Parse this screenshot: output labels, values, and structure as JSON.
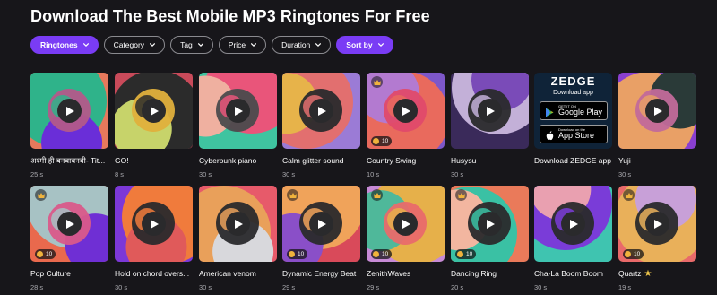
{
  "page_title": "Download The Best Mobile MP3 Ringtones For Free",
  "filters": [
    {
      "label": "Ringtones",
      "active": true
    },
    {
      "label": "Category",
      "active": false
    },
    {
      "label": "Tag",
      "active": false
    },
    {
      "label": "Price",
      "active": false
    },
    {
      "label": "Duration",
      "active": false
    },
    {
      "label": "Sort by",
      "active": true
    }
  ],
  "colors": {
    "accent": "#7a3cf5",
    "background": "#17161a",
    "coin": "#f0b33c"
  },
  "rows": [
    [
      {
        "name": "अश्मी ही बनवाबनवी- Tit...",
        "duration": "25 s",
        "premium": false,
        "price": "",
        "palette": [
          "#e6795c",
          "#2fb38a",
          "#6a2ed8",
          "#b35a8a"
        ]
      },
      {
        "name": "GO!",
        "duration": "8 s",
        "premium": false,
        "price": "",
        "palette": [
          "#c94a5a",
          "#2b2b2b",
          "#c7d36a",
          "#e0b03c"
        ]
      },
      {
        "name": "Cyberpunk piano",
        "duration": "30 s",
        "premium": false,
        "price": "",
        "palette": [
          "#3fc4a0",
          "#e9557a",
          "#efb0a0",
          "#4b4b4d"
        ]
      },
      {
        "name": "Calm glitter sound",
        "duration": "30 s",
        "premium": false,
        "price": "",
        "palette": [
          "#9b7bd6",
          "#e26f6f",
          "#e7b34a",
          "#2a2a2c"
        ]
      },
      {
        "name": "Country Swing",
        "duration": "10 s",
        "premium": true,
        "price": "10",
        "palette": [
          "#7d57c9",
          "#e96a5d",
          "#b37ad0",
          "#e04a6a"
        ]
      },
      {
        "name": "Husysu",
        "duration": "30 s",
        "premium": false,
        "price": "",
        "palette": [
          "#3a2a5a",
          "#c3b0d8",
          "#7a4bb8",
          "#2a2a2c"
        ]
      },
      {
        "type": "ad",
        "name": "Download ZEDGE app",
        "logo": "ZEDGE",
        "subtitle": "Download app",
        "google_small": "GET IT ON",
        "google_big": "Google Play",
        "apple_small": "Download on the",
        "apple_big": "App Store"
      },
      {
        "name": "Yuji",
        "duration": "30 s",
        "premium": false,
        "price": "",
        "palette": [
          "#8a3fd0",
          "#e9a066",
          "#2a3a38",
          "#c26a9a"
        ]
      }
    ],
    [
      {
        "name": "Pop Culture",
        "duration": "28 s",
        "premium": true,
        "price": "10",
        "palette": [
          "#e9694d",
          "#a7c2c4",
          "#6f2fd4",
          "#d95a8a"
        ]
      },
      {
        "name": "Hold on chord overs...",
        "duration": "30 s",
        "premium": false,
        "price": "",
        "palette": [
          "#7c38d8",
          "#f07b3c",
          "#e05a5a",
          "#2a2a2c"
        ]
      },
      {
        "name": "American venom",
        "duration": "30 s",
        "premium": false,
        "price": "",
        "palette": [
          "#e75a6a",
          "#e9a05a",
          "#d8d8dc",
          "#2a2a2c"
        ]
      },
      {
        "name": "Dynamic Energy Beat",
        "duration": "29 s",
        "premium": true,
        "price": "10",
        "palette": [
          "#d94a5a",
          "#f0a35a",
          "#8a4fc8",
          "#2a2a2c"
        ]
      },
      {
        "name": "ZenithWaves",
        "duration": "29 s",
        "premium": true,
        "price": "10",
        "palette": [
          "#c78ad6",
          "#e6b04a",
          "#4fb89a",
          "#e96a6a"
        ]
      },
      {
        "name": "Dancing Ring",
        "duration": "20 s",
        "premium": true,
        "price": "10",
        "palette": [
          "#ea7a5a",
          "#3ac1a4",
          "#f2b6a0",
          "#2a2a2c"
        ]
      },
      {
        "name": "Cha-La Boom Boom",
        "duration": "30 s",
        "premium": false,
        "price": "",
        "palette": [
          "#3fc4b0",
          "#7a3cd8",
          "#e9a0b0",
          "#2a2a2c"
        ]
      },
      {
        "name": "Quartz",
        "duration": "19 s",
        "premium": true,
        "price": "10",
        "star": true,
        "palette": [
          "#e96a6a",
          "#e9b05a",
          "#c8a0d8",
          "#2a2a2c"
        ]
      }
    ]
  ]
}
